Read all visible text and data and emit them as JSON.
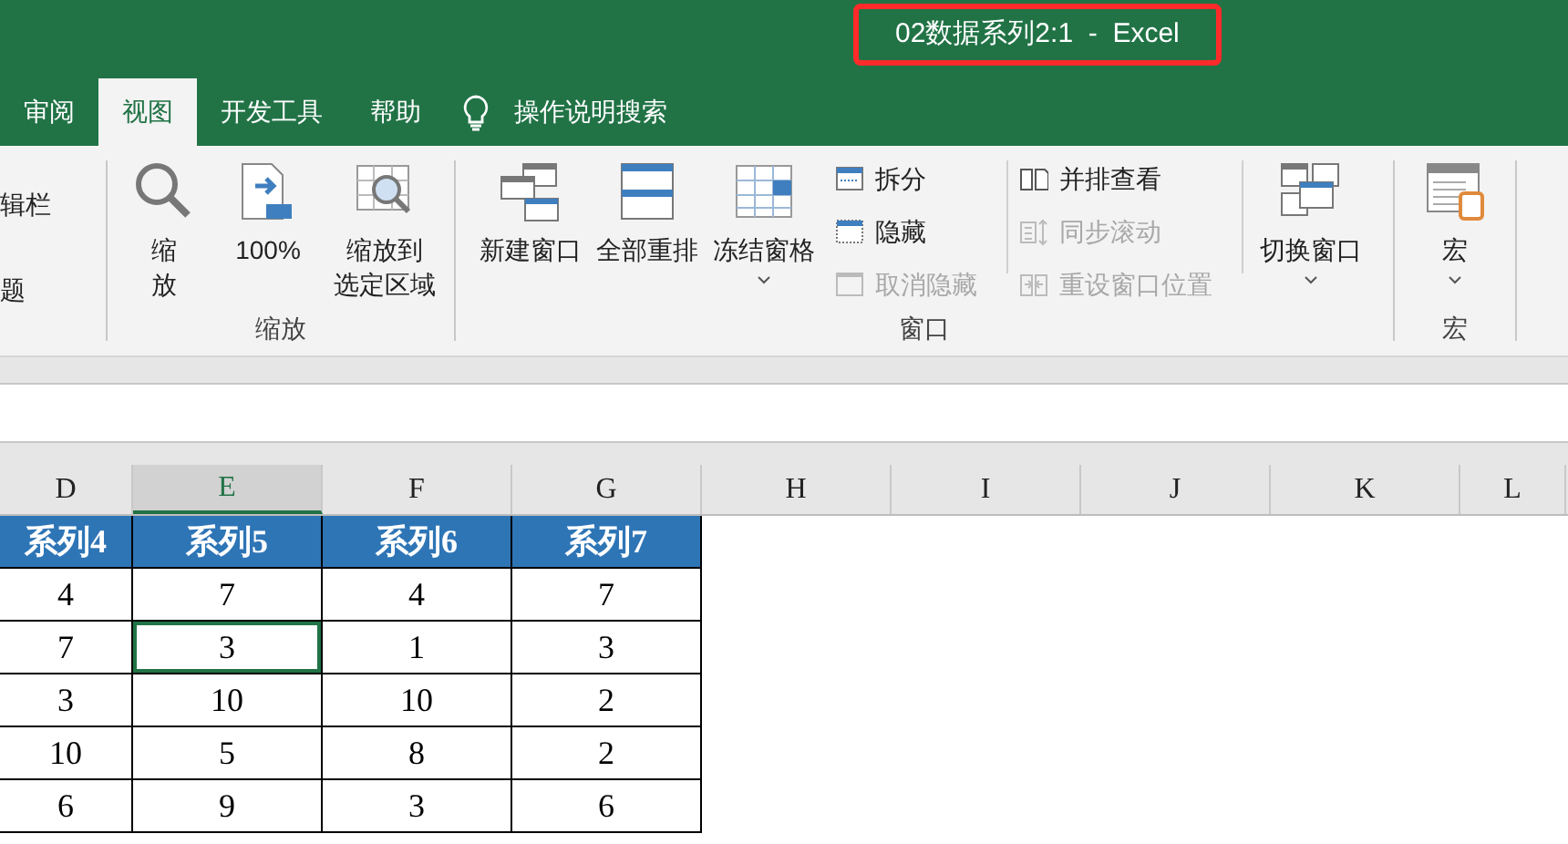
{
  "title_bar": {
    "title": "02数据系列2:1  -  Excel",
    "highlighted": true
  },
  "tabs": [
    {
      "label": "审阅",
      "selected": false
    },
    {
      "label": "视图",
      "selected": true
    },
    {
      "label": "开发工具",
      "selected": false
    },
    {
      "label": "帮助",
      "selected": false
    }
  ],
  "search": {
    "label": "操作说明搜索"
  },
  "ribbon": {
    "groups": [
      {
        "kind": "partial",
        "items": [
          {
            "label": "辑栏"
          },
          {
            "label": "题"
          }
        ]
      },
      {
        "kind": "zoom",
        "label": "缩放",
        "buttons": [
          {
            "lines": [
              "缩",
              "放"
            ],
            "dropdown": false
          },
          {
            "lines": [
              "100%"
            ],
            "dropdown": false
          },
          {
            "lines": [
              "缩放到",
              "选定区域"
            ],
            "dropdown": false
          }
        ]
      },
      {
        "kind": "window",
        "label": "窗口",
        "buttons": [
          {
            "lines": [
              "新建窗口"
            ],
            "dropdown": false
          },
          {
            "lines": [
              "全部重排"
            ],
            "dropdown": false
          },
          {
            "lines": [
              "冻结窗格"
            ],
            "dropdown": true
          }
        ],
        "small_columns": [
          [
            {
              "label": "拆分",
              "disabled": false
            },
            {
              "label": "隐藏",
              "disabled": false
            },
            {
              "label": "取消隐藏",
              "disabled": true
            }
          ],
          [
            {
              "label": "并排查看",
              "disabled": false
            },
            {
              "label": "同步滚动",
              "disabled": true
            },
            {
              "label": "重设窗口位置",
              "disabled": true
            }
          ]
        ],
        "end_buttons": [
          {
            "lines": [
              "切换窗口"
            ],
            "dropdown": true
          }
        ]
      },
      {
        "kind": "macro",
        "label": "宏",
        "buttons": [
          {
            "lines": [
              "宏"
            ],
            "dropdown": true
          }
        ]
      }
    ]
  },
  "columns": [
    {
      "label": "D",
      "selected": false
    },
    {
      "label": "E",
      "selected": true
    },
    {
      "label": "F",
      "selected": false
    },
    {
      "label": "G",
      "selected": false
    },
    {
      "label": "H",
      "selected": false
    },
    {
      "label": "I",
      "selected": false
    },
    {
      "label": "J",
      "selected": false
    },
    {
      "label": "K",
      "selected": false
    },
    {
      "label": "L",
      "selected": false
    }
  ],
  "header_row": [
    "系列4",
    "系列5",
    "系列6",
    "系列7"
  ],
  "rows": [
    [
      {
        "text": "4",
        "selected": false
      },
      {
        "text": "7",
        "selected": false
      },
      {
        "text": "4",
        "selected": false
      },
      {
        "text": "7",
        "selected": false
      }
    ],
    [
      {
        "text": "7",
        "selected": false
      },
      {
        "text": "3",
        "selected": true
      },
      {
        "text": "1",
        "selected": false
      },
      {
        "text": "3",
        "selected": false
      }
    ],
    [
      {
        "text": "3",
        "selected": false
      },
      {
        "text": "10",
        "selected": false
      },
      {
        "text": "10",
        "selected": false
      },
      {
        "text": "2",
        "selected": false
      }
    ],
    [
      {
        "text": "10",
        "selected": false
      },
      {
        "text": "5",
        "selected": false
      },
      {
        "text": "8",
        "selected": false
      },
      {
        "text": "2",
        "selected": false
      }
    ],
    [
      {
        "text": "6",
        "selected": false
      },
      {
        "text": "9",
        "selected": false
      },
      {
        "text": "3",
        "selected": false
      },
      {
        "text": "6",
        "selected": false
      }
    ]
  ]
}
